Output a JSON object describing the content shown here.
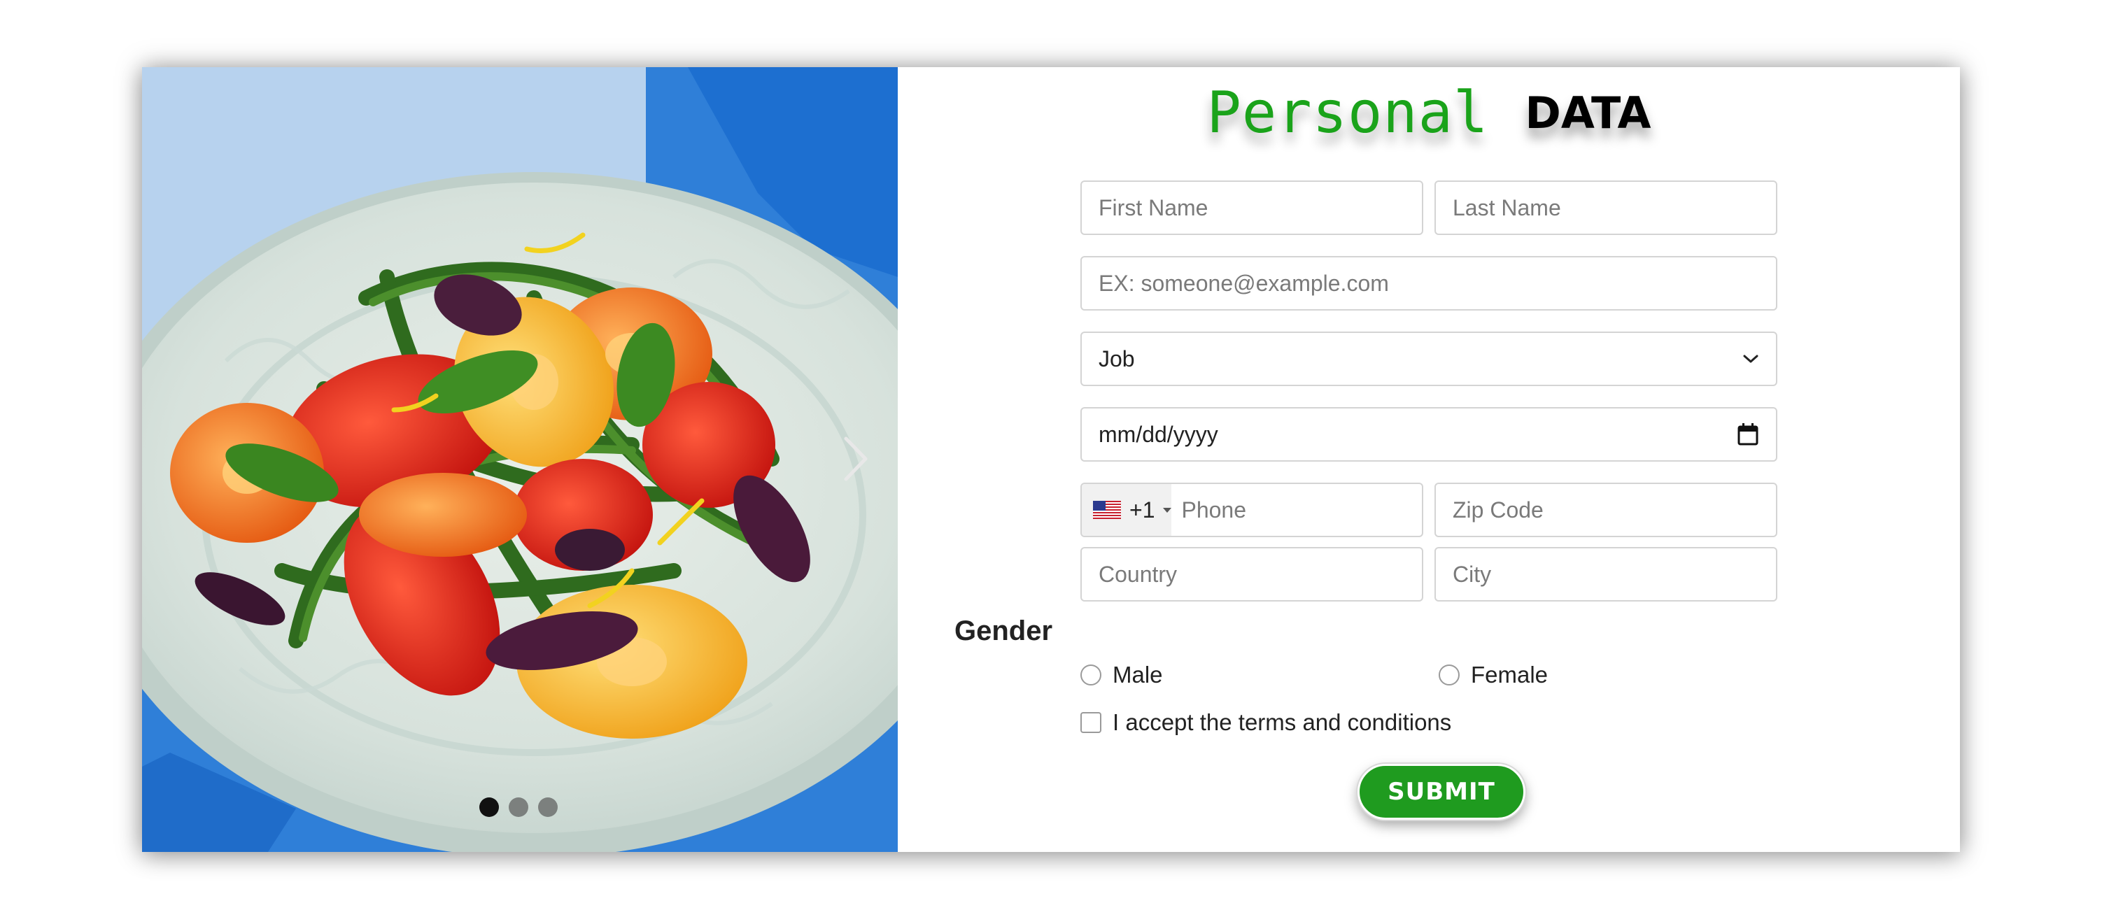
{
  "carousel": {
    "image_alt": "Salad of tomatoes, green beans and basil on a white plate",
    "next_icon": "chevron-right-icon",
    "indicators": [
      {
        "active": true
      },
      {
        "active": false
      },
      {
        "active": false
      }
    ]
  },
  "title": {
    "word1": "Personal",
    "word2": "DATA",
    "word1_color": "#1aa31a",
    "word2_color": "#000000"
  },
  "form": {
    "first_name_placeholder": "First Name",
    "last_name_placeholder": "Last Name",
    "email_placeholder": "EX: someone@example.com",
    "job_selected": "Job",
    "date_placeholder": "mm/dd/yyyy",
    "phone_country_code": "+1",
    "phone_country_flag": "us-flag-icon",
    "phone_placeholder": "Phone",
    "zip_placeholder": "Zip Code",
    "country_placeholder": "Country",
    "city_placeholder": "City",
    "gender_label": "Gender",
    "gender_male": "Male",
    "gender_female": "Female",
    "terms_label": "I accept the terms and conditions",
    "submit_label": "SUBMIT",
    "submit_color": "#1f9b1f"
  }
}
